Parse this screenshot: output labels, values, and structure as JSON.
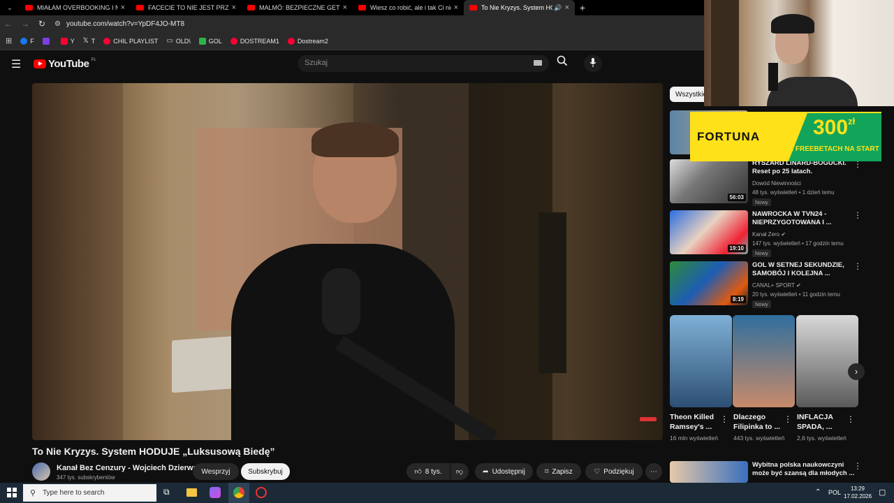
{
  "browser": {
    "tabs": [
      {
        "title": "MIAŁAM OVERBOOKING I NIE",
        "active": false
      },
      {
        "title": "FACECIE TO NIE JEST PRZYPAD",
        "active": false
      },
      {
        "title": "MALMÖ: BEZPIECZNE GETTO",
        "active": false
      },
      {
        "title": "Wiesz co robić, ale i tak Ci nie w",
        "active": false
      },
      {
        "title": "To Nie Kryzys. System HOD",
        "active": true
      }
    ],
    "url": "youtube.com/watch?v=YpDF4JO-MT8",
    "bookmarks": [
      {
        "label": "F",
        "color": "#1877f2"
      },
      {
        "label": "",
        "color": "#7b3fe4"
      },
      {
        "label": "Y",
        "color": "#ff0033"
      },
      {
        "label": "T",
        "color": "#ffffff"
      },
      {
        "label": "CHIL PLAYLIST",
        "color": "#ff0033"
      },
      {
        "label": "OLD\\",
        "color": "#999999"
      },
      {
        "label": "GOL",
        "color": "#2db34a"
      },
      {
        "label": "DOSTREAM1",
        "color": "#ff0033"
      },
      {
        "label": "Dostream2",
        "color": "#ff0033"
      }
    ]
  },
  "youtube": {
    "logo": "YouTube",
    "region": "PL",
    "search_placeholder": "Szukaj",
    "video_title": "To Nie Kryzys. System HODUJE „Luksusową Biedę”",
    "channel_name": "Kanał Bez Cenzury - Wojciech Dzierwa",
    "subscribers": "347 tys. subskrybentów",
    "buttons": {
      "support": "Wesprzyj",
      "subscribe": "Subskrybuj",
      "likes": "8 tys.",
      "share": "Udostępnij",
      "save": "Zapisz",
      "thanks": "Podziękuj"
    },
    "chips_first": "Wszystkie",
    "recommendations": [
      {
        "title": "RYSZARD LINARD-BOGUCKI. Reset po 25 latach.",
        "channel": "Dowód Niewinności",
        "meta": "48 tys. wyświetleń • 1 dzień temu",
        "badge": "Nowy",
        "duration": "56:03",
        "verified": false
      },
      {
        "title": "NAWROCKA W TVN24 - NIEPRZYGOTOWANA I ...",
        "channel": "Kanał Zero",
        "meta": "147 tys. wyświetleń • 17 godzin temu",
        "badge": "Nowy",
        "duration": "19:10",
        "verified": true
      },
      {
        "title": "GOL W SETNEJ SEKUNDZIE, SAMOBÓJ I KOLEJNA ...",
        "channel": "CANAL+ SPORT",
        "meta": "20 tys. wyświetleń • 11 godzin temu",
        "badge": "Nowy",
        "duration": "8:19",
        "verified": true
      }
    ],
    "shorts": [
      {
        "title": "Theon Killed Ramsey's ...",
        "views": "16 mln wyświetleń"
      },
      {
        "title": "Dlaczego Filipinka to ...",
        "views": "443 tys. wyświetleń"
      },
      {
        "title": "INFLACJA SPADA, ...",
        "views": "2,6 tys. wyświetleń"
      }
    ],
    "next_item_title": "Wybitna polska naukowczyni może być szansą dla młodych ..."
  },
  "overlay": {
    "ad_brand": "FORTUNA",
    "ad_amount": "300",
    "ad_currency": "zł",
    "ad_tagline": "WE FREEBETACH NA START"
  },
  "taskbar": {
    "search_placeholder": "Type here to search",
    "language": "POL",
    "time": "13:29",
    "date": "17.02.2026"
  }
}
